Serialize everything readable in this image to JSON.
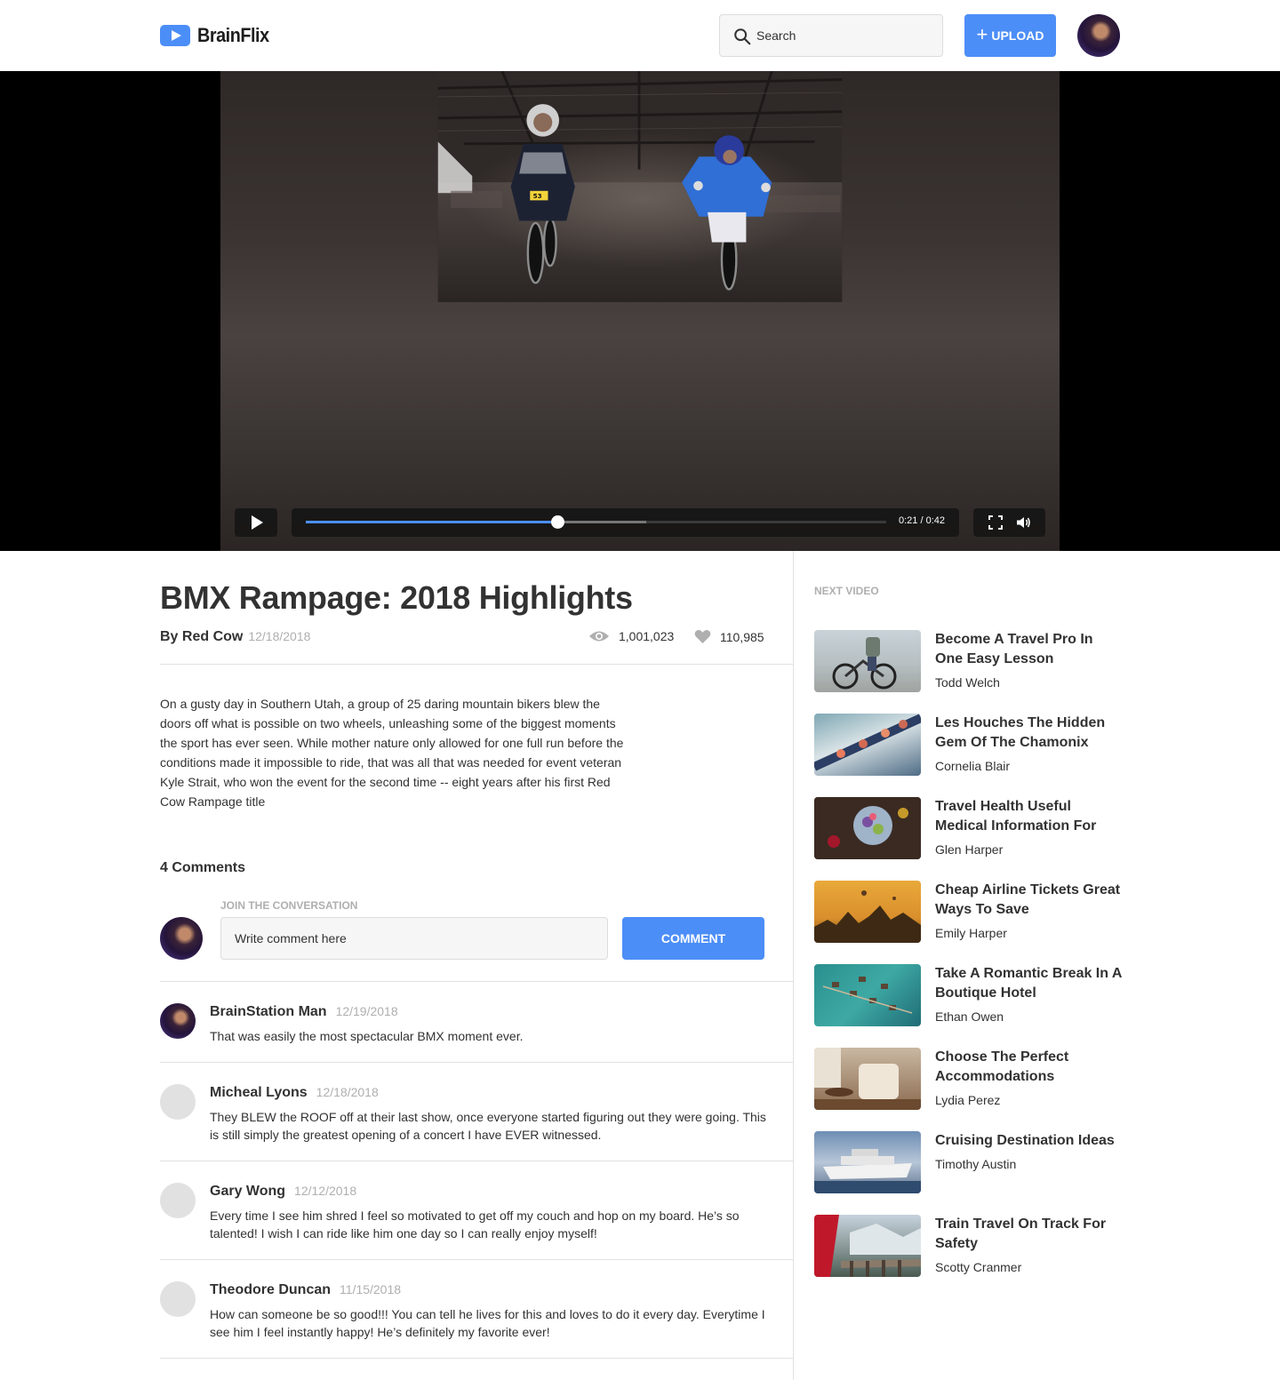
{
  "header": {
    "logo_text": "BrainFlix",
    "search_placeholder": "Search",
    "upload_label": "UPLOAD"
  },
  "player": {
    "time_display": "0:21 / 0:42",
    "progress": 0.434,
    "buffered": 0.587
  },
  "video": {
    "title": "BMX Rampage: 2018 Highlights",
    "channel": "By Red Cow",
    "date": "12/18/2018",
    "views": "1,001,023",
    "likes": "110,985",
    "description": "On a gusty day in Southern Utah, a group of 25 daring mountain bikers blew the doors off what is possible on two wheels, unleashing some of the biggest moments the sport has ever seen. While mother nature only allowed for one full run before the conditions made it impossible to ride, that was all that was needed for event veteran Kyle Strait, who won the event for the second time -- eight years after his first Red Cow Rampage title"
  },
  "comments": {
    "count_label": "4 Comments",
    "join_label": "JOIN THE CONVERSATION",
    "input_placeholder": "Write comment here",
    "button_label": "COMMENT",
    "items": [
      {
        "name": "BrainStation Man",
        "date": "12/19/2018",
        "text": "That was easily the most spectacular BMX moment ever."
      },
      {
        "name": "Micheal Lyons",
        "date": "12/18/2018",
        "text": "They BLEW the ROOF off at their last show, once everyone started figuring out they were going. This is still simply the greatest opening of a concert I have EVER witnessed."
      },
      {
        "name": "Gary Wong",
        "date": "12/12/2018",
        "text": "Every time I see him shred I feel so motivated to get off my couch and hop on my board. He’s so talented! I wish I can ride like him one day so I can really enjoy myself!"
      },
      {
        "name": "Theodore Duncan",
        "date": "11/15/2018",
        "text": "How can someone be so good!!! You can tell he lives for this and loves to do it every day. Everytime I see him I feel instantly happy! He’s definitely my favorite ever!"
      }
    ]
  },
  "next_videos": {
    "label": "NEXT VIDEO",
    "items": [
      {
        "title": "Become A Travel Pro In One Easy Lesson",
        "channel": "Todd Welch"
      },
      {
        "title": "Les Houches The Hidden Gem Of The Chamonix",
        "channel": "Cornelia Blair"
      },
      {
        "title": "Travel Health Useful Medical Information For",
        "channel": "Glen Harper"
      },
      {
        "title": "Cheap Airline Tickets Great Ways To Save",
        "channel": "Emily Harper"
      },
      {
        "title": "Take A Romantic Break In A Boutique Hotel",
        "channel": "Ethan Owen"
      },
      {
        "title": "Choose The Perfect Accommodations",
        "channel": "Lydia Perez"
      },
      {
        "title": "Cruising Destination Ideas",
        "channel": "Timothy Austin"
      },
      {
        "title": "Train Travel On Track For Safety",
        "channel": "Scotty Cranmer"
      }
    ]
  },
  "colors": {
    "accent": "#4c8ef7",
    "text": "#323232",
    "muted": "#afafaf",
    "border": "#e1e1e1"
  }
}
